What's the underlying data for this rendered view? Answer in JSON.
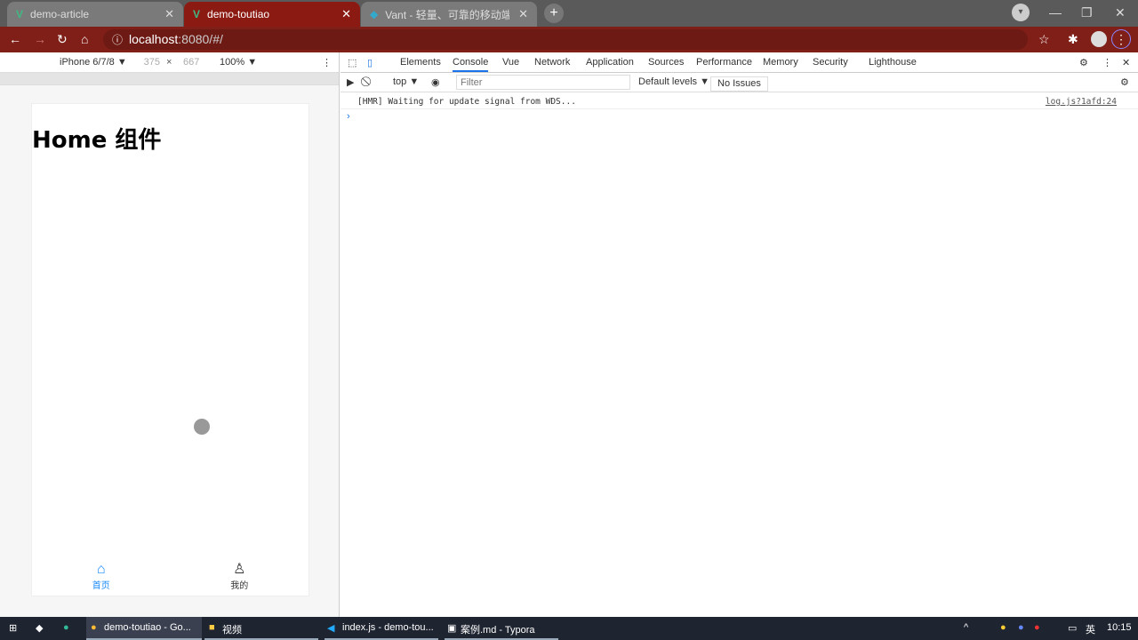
{
  "browser": {
    "tabs": [
      {
        "title": "demo-article"
      },
      {
        "title": "demo-toutiao"
      },
      {
        "title": "Vant - 轻量、可靠的移动端组件"
      }
    ],
    "url_host": "localhost",
    "url_path": ":8080/#/"
  },
  "emulation": {
    "device": "iPhone 6/7/8 ▼",
    "width": "375",
    "height": "667",
    "zoom": "100% ▼",
    "times": "×"
  },
  "page": {
    "heading": "Home 组件",
    "tabs": [
      {
        "label": "首页",
        "icon": "home-icon"
      },
      {
        "label": "我的",
        "icon": "user-icon"
      }
    ],
    "accent": "#1989fa"
  },
  "devtools": {
    "tabs": [
      "Elements",
      "Console",
      "Vue",
      "Network",
      "Application",
      "Sources",
      "Performance",
      "Memory",
      "Security",
      "Lighthouse"
    ],
    "active_tab": "Console",
    "context": "top ▼",
    "filter_placeholder": "Filter",
    "levels": "Default levels ▼",
    "issues": "No Issues",
    "logs": [
      {
        "message": "[HMR] Waiting for update signal from WDS...",
        "source": "log.js?1afd:24"
      }
    ],
    "prompt": "›"
  },
  "taskbar": {
    "items": [
      "demo-toutiao - Go...",
      "视频",
      "index.js - demo-tou...",
      "案例.md - Typora"
    ],
    "ime": "英",
    "time": "10:15"
  }
}
